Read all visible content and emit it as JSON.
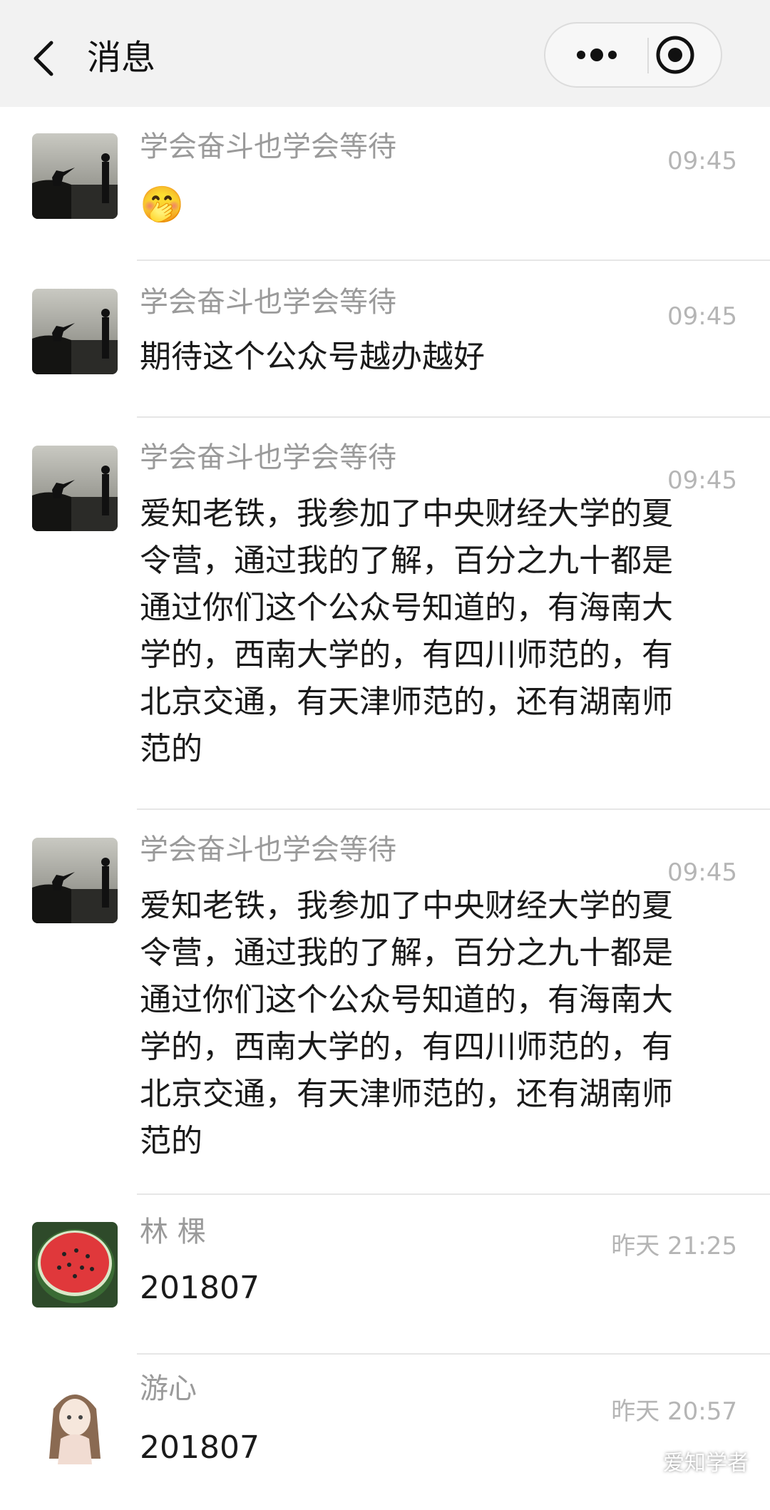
{
  "header": {
    "title": "消息"
  },
  "messages": [
    {
      "name": "学会奋斗也学会等待",
      "time": "09:45",
      "text": "🤭"
    },
    {
      "name": "学会奋斗也学会等待",
      "time": "09:45",
      "text": "期待这个公众号越办越好"
    },
    {
      "name": "学会奋斗也学会等待",
      "time": "09:45",
      "text": "爱知老铁，我参加了中央财经大学的夏\n令营，通过我的了解，百分之九十都是\n通过你们这个公众号知道的，有海南大\n学的，西南大学的，有四川师范的，有\n北京交通，有天津师范的，还有湖南师\n范的"
    },
    {
      "name": "学会奋斗也学会等待",
      "time": "09:45",
      "text": "爱知老铁，我参加了中央财经大学的夏\n令营，通过我的了解，百分之九十都是\n通过你们这个公众号知道的，有海南大\n学的，西南大学的，有四川师范的，有\n北京交通，有天津师范的，还有湖南师\n范的"
    },
    {
      "name": "林 棵",
      "time": "昨天 21:25",
      "text": "201807"
    },
    {
      "name": "游心",
      "time": "昨天 20:57",
      "text": "201807"
    }
  ],
  "watermark": "爱知学者",
  "colors": {
    "header_bg": "#f2f2f2",
    "name": "#9a9a9a",
    "time": "#b5b5b5",
    "divider": "#e6e6e6"
  }
}
